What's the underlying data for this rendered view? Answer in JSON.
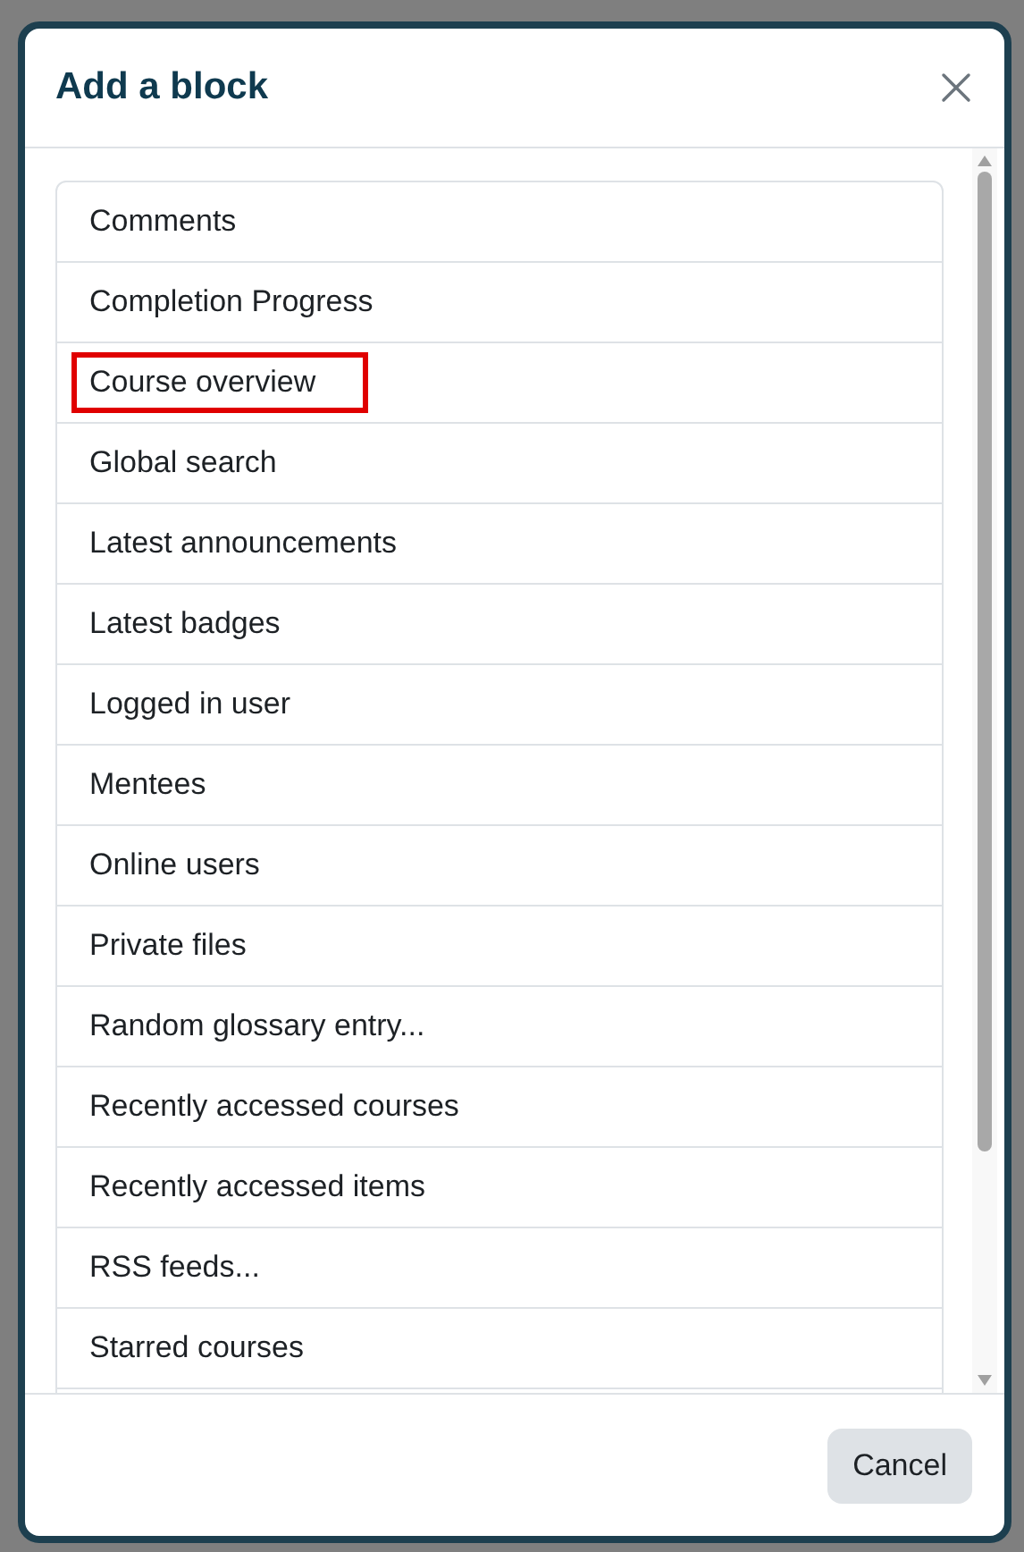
{
  "dialog": {
    "title": "Add a block"
  },
  "blocks": [
    {
      "label": "Comments",
      "highlighted": false
    },
    {
      "label": "Completion Progress",
      "highlighted": false
    },
    {
      "label": "Course overview",
      "highlighted": true
    },
    {
      "label": "Global search",
      "highlighted": false
    },
    {
      "label": "Latest announcements",
      "highlighted": false
    },
    {
      "label": "Latest badges",
      "highlighted": false
    },
    {
      "label": "Logged in user",
      "highlighted": false
    },
    {
      "label": "Mentees",
      "highlighted": false
    },
    {
      "label": "Online users",
      "highlighted": false
    },
    {
      "label": "Private files",
      "highlighted": false
    },
    {
      "label": "Random glossary entry...",
      "highlighted": false
    },
    {
      "label": "Recently accessed courses",
      "highlighted": false
    },
    {
      "label": "Recently accessed items",
      "highlighted": false
    },
    {
      "label": "RSS feeds...",
      "highlighted": false
    },
    {
      "label": "Starred courses",
      "highlighted": false
    }
  ],
  "footer": {
    "cancel": "Cancel"
  }
}
